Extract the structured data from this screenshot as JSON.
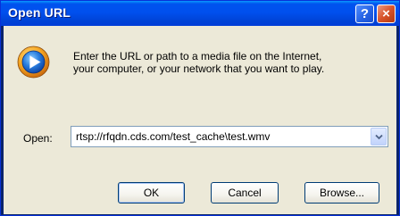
{
  "window": {
    "title": "Open URL",
    "help_label": "?",
    "close_label": "×"
  },
  "message": {
    "line1": "Enter the URL or path to a media file on the Internet,",
    "line2": "your computer, or your network that you want to play."
  },
  "open_field": {
    "label": "Open:",
    "value": "rtsp://rfqdn.cds.com/test_cache\\test.wmv"
  },
  "buttons": {
    "ok": "OK",
    "cancel": "Cancel",
    "browse": "Browse..."
  },
  "colors": {
    "titlebar": "#0053ee",
    "client_bg": "#ece9d8",
    "close_button": "#d9532a",
    "help_button": "#2663e4"
  },
  "icons": {
    "media": "windows-media-player-icon",
    "dropdown": "chevron-down-icon"
  }
}
